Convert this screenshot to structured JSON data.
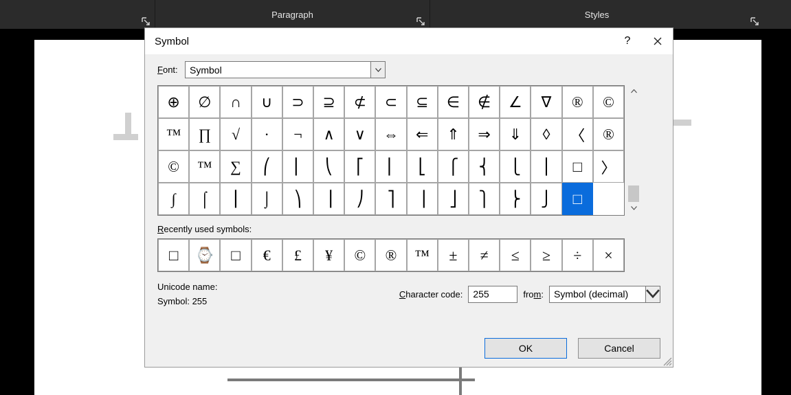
{
  "ribbon": {
    "groups": [
      "",
      "Paragraph",
      "Styles"
    ]
  },
  "dialog": {
    "title": "Symbol",
    "help": "?",
    "font_label_pre": "F",
    "font_label_u": "o",
    "font_label_post": "nt:",
    "font_value": "Symbol",
    "grid": [
      [
        "⊕",
        "∅",
        "∩",
        "∪",
        "⊃",
        "⊇",
        "⊄",
        "⊂",
        "⊆",
        "∈",
        "∉",
        "∠",
        "∇",
        "®",
        "©"
      ],
      [
        "™",
        "∏",
        "√",
        "·",
        "¬",
        "∧",
        "∨",
        "⇔",
        "⇐",
        "⇑",
        "⇒",
        "⇓",
        "◊",
        "〈",
        "®"
      ],
      [
        "©",
        "™",
        "∑",
        "⎛",
        "⎜",
        "⎝",
        "⎡",
        "⎢",
        "⎣",
        "⎧",
        "⎨",
        "⎩",
        "⎪",
        "□",
        "〉"
      ],
      [
        "∫",
        "⌠",
        "⎮",
        "⌡",
        "⎞",
        "⎟",
        "⎠",
        "⎤",
        "⎥",
        "⎦",
        "⎫",
        "⎬",
        "⎭",
        "□",
        ""
      ]
    ],
    "grid_selected": {
      "row": 3,
      "col": 13
    },
    "recent_label_pre": "R",
    "recent_label_u": "e",
    "recent_label_post": "cently used symbols:",
    "recent": [
      "□",
      "⌚",
      "□",
      "€",
      "£",
      "¥",
      "©",
      "®",
      "™",
      "±",
      "≠",
      "≤",
      "≥",
      "÷",
      "×"
    ],
    "unicode_name_label": "Unicode name:",
    "unicode_name_value": "Symbol: 255",
    "cc_label_pre": "C",
    "cc_label_u": "h",
    "cc_label_post": "aracter code:",
    "cc_value": "255",
    "from_label_pre": "fro",
    "from_label_u": "m",
    "from_label_post": ":",
    "from_value": "Symbol (decimal)",
    "ok": "OK",
    "cancel": "Cancel"
  }
}
